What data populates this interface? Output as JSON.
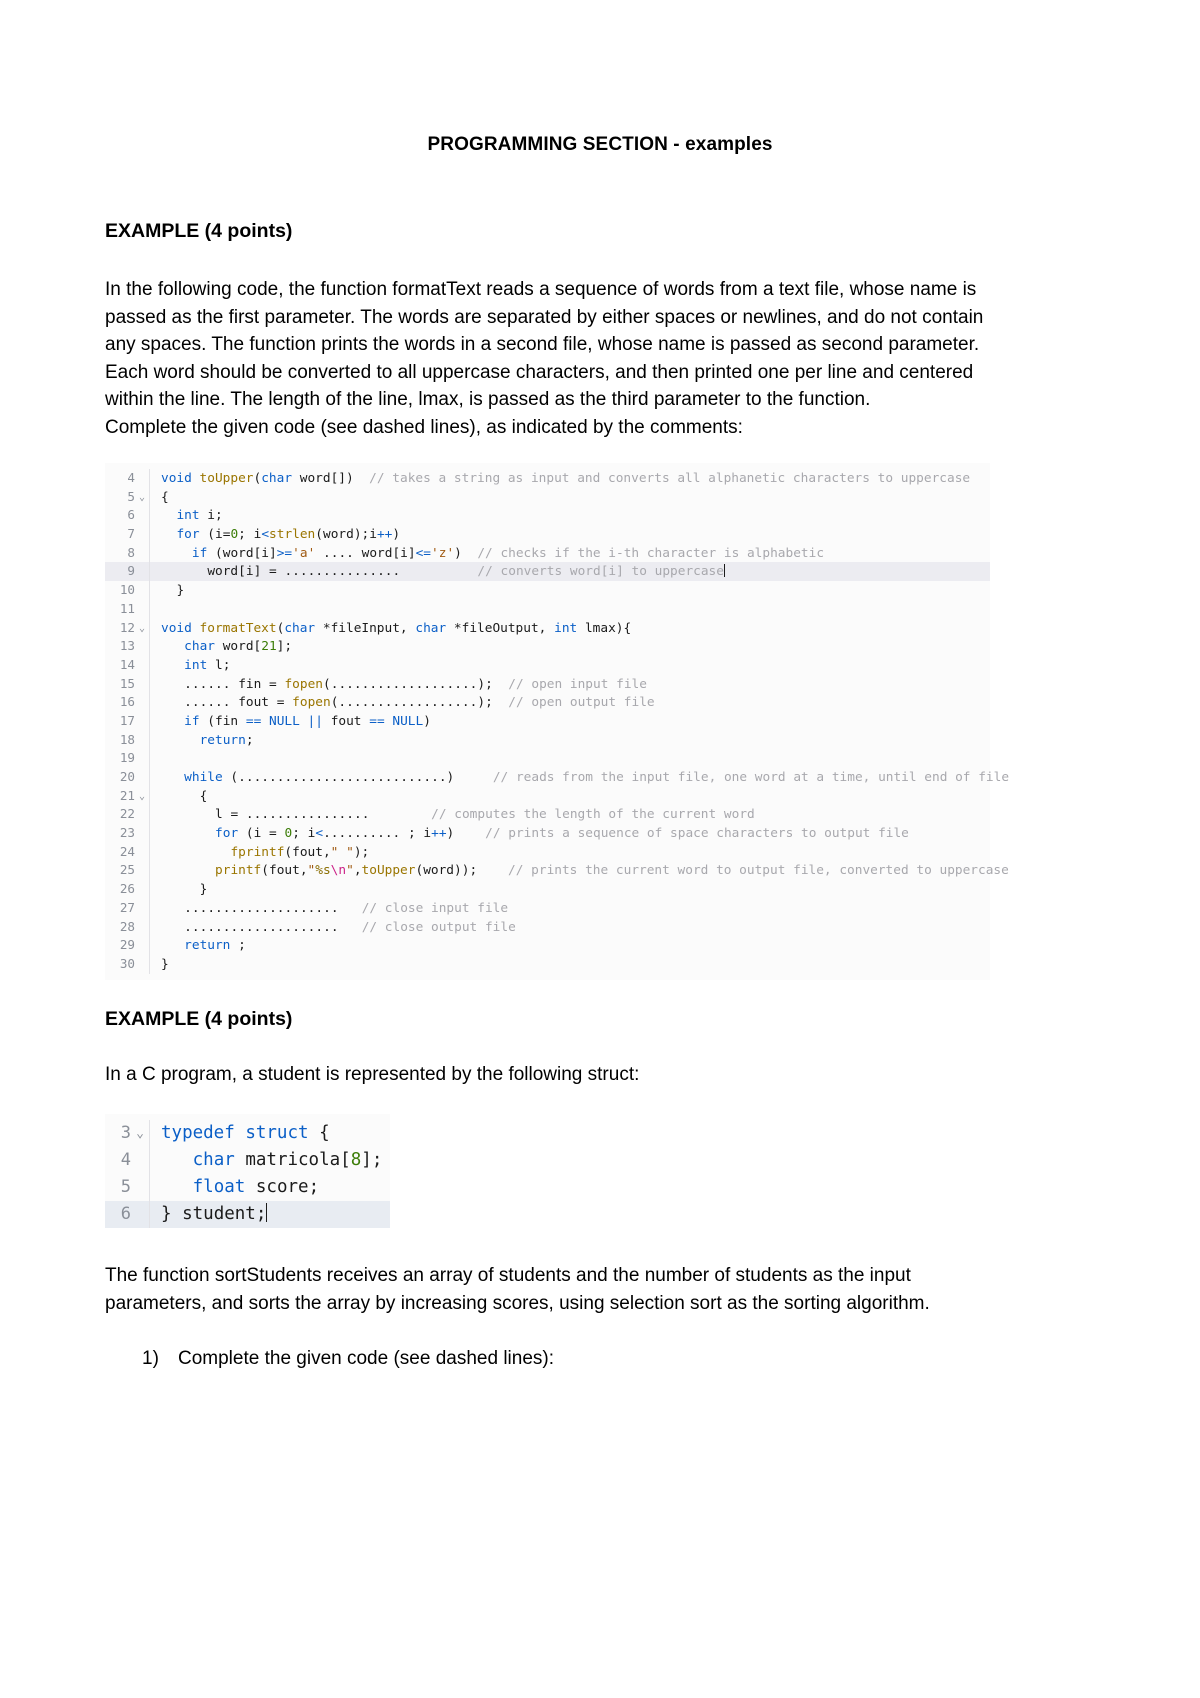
{
  "document": {
    "title": "PROGRAMMING SECTION - examples",
    "sections": [
      {
        "heading": "EXAMPLE (4 points)",
        "paragraph": "In the following code, the function formatText reads a sequence of words from a text file, whose name is passed as the first parameter. The words are separated by either spaces or newlines, and do not contain any spaces. The function prints the words in a second file, whose name is passed as second parameter. Each word should be converted to all uppercase characters, and then printed one per line and centered within the line. The length of the line, lmax, is passed as the third parameter to the function.",
        "instruction": "Complete the given code (see dashed lines), as indicated by the comments:"
      },
      {
        "heading": "EXAMPLE (4 points)",
        "paragraph": "In a C program, a student is represented by the following struct:",
        "closing": "The function sortStudents receives an array of students and the number of students as the input parameters, and sorts the array by increasing scores, using selection sort as the sorting algorithm.",
        "list_number": "1)",
        "list_item": "Complete the given code (see dashed lines):"
      }
    ]
  },
  "code_block_1": {
    "lines": [
      {
        "n": "4",
        "fold": "",
        "highlight": false,
        "code": "void toUpper(char word[])  // takes a string as input and converts all alphanetic characters to uppercase"
      },
      {
        "n": "5",
        "fold": "v",
        "highlight": false,
        "code": "{"
      },
      {
        "n": "6",
        "fold": "",
        "highlight": false,
        "code": "  int i;"
      },
      {
        "n": "7",
        "fold": "",
        "highlight": false,
        "code": "  for (i=0; i<strlen(word);i++)"
      },
      {
        "n": "8",
        "fold": "",
        "highlight": false,
        "code": "    if (word[i]>='a' .... word[i]<='z')  // checks if the i-th character is alphabetic"
      },
      {
        "n": "9",
        "fold": "",
        "highlight": true,
        "code": "      word[i] = ...............          // converts word[i] to uppercase"
      },
      {
        "n": "10",
        "fold": "",
        "highlight": false,
        "code": "  }"
      },
      {
        "n": "11",
        "fold": "",
        "highlight": false,
        "code": ""
      },
      {
        "n": "12",
        "fold": "v",
        "highlight": false,
        "code": "void formatText(char *fileInput, char *fileOutput, int lmax){"
      },
      {
        "n": "13",
        "fold": "",
        "highlight": false,
        "code": "   char word[21];"
      },
      {
        "n": "14",
        "fold": "",
        "highlight": false,
        "code": "   int l;"
      },
      {
        "n": "15",
        "fold": "",
        "highlight": false,
        "code": "   ...... fin = fopen(...................);  // open input file"
      },
      {
        "n": "16",
        "fold": "",
        "highlight": false,
        "code": "   ...... fout = fopen(..................);  // open output file"
      },
      {
        "n": "17",
        "fold": "",
        "highlight": false,
        "code": "   if (fin == NULL || fout == NULL)"
      },
      {
        "n": "18",
        "fold": "",
        "highlight": false,
        "code": "     return;"
      },
      {
        "n": "19",
        "fold": "",
        "highlight": false,
        "code": ""
      },
      {
        "n": "20",
        "fold": "",
        "highlight": false,
        "code": "   while (...........................)     // reads from the input file, one word at a time, until end of file"
      },
      {
        "n": "21",
        "fold": "v",
        "highlight": false,
        "code": "     {"
      },
      {
        "n": "22",
        "fold": "",
        "highlight": false,
        "code": "       l = ................        // computes the length of the current word"
      },
      {
        "n": "23",
        "fold": "",
        "highlight": false,
        "code": "       for (i = 0; i<.......... ; i++)    // prints a sequence of space characters to output file"
      },
      {
        "n": "24",
        "fold": "",
        "highlight": false,
        "code": "         fprintf(fout,\" \");"
      },
      {
        "n": "25",
        "fold": "",
        "highlight": false,
        "code": "       printf(fout,\"%s\\n\",toUpper(word));    // prints the current word to output file, converted to uppercase"
      },
      {
        "n": "26",
        "fold": "",
        "highlight": false,
        "code": "     }"
      },
      {
        "n": "27",
        "fold": "",
        "highlight": false,
        "code": "   ....................   // close input file"
      },
      {
        "n": "28",
        "fold": "",
        "highlight": false,
        "code": "   ....................   // close output file"
      },
      {
        "n": "29",
        "fold": "",
        "highlight": false,
        "code": "   return ;"
      },
      {
        "n": "30",
        "fold": "",
        "highlight": false,
        "code": "}"
      }
    ]
  },
  "code_block_2": {
    "lines": [
      {
        "n": "3",
        "fold": "v",
        "highlight": false,
        "code": "typedef struct {"
      },
      {
        "n": "4",
        "fold": "",
        "highlight": false,
        "code": "   char matricola[8];"
      },
      {
        "n": "5",
        "fold": "",
        "highlight": false,
        "code": "   float score;"
      },
      {
        "n": "6",
        "fold": "",
        "highlight": true,
        "code": "} student;"
      }
    ]
  },
  "colors": {
    "keyword": "#0b5fc7",
    "function": "#9a7500",
    "number": "#3c7d08",
    "string": "#a05a12",
    "comment": "#a8a8ad",
    "escape": "#cc2288",
    "highlight_bg": "#ececf1",
    "code_bg": "#fbfbfb",
    "line_number": "#8a8f98"
  }
}
